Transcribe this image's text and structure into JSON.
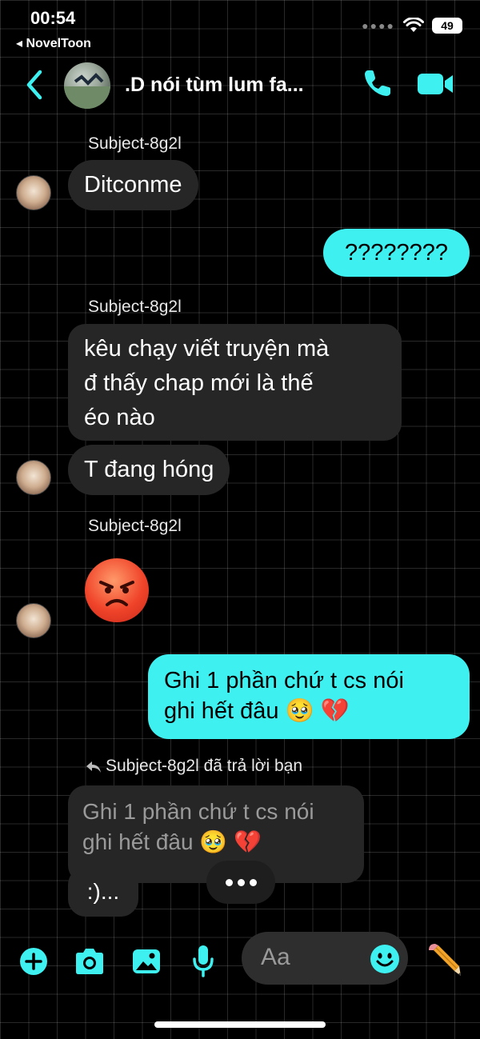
{
  "status": {
    "time": "00:54",
    "back_app": "◂ NovelToon",
    "battery": "49"
  },
  "header": {
    "title": ".D nói tùm lum fa..."
  },
  "messages": {
    "sender1": "Subject-8g2l",
    "m1": "Ditconme",
    "m2": "????????",
    "sender2": "Subject-8g2l",
    "m3_line1": "kêu chạy viết truyện mà",
    "m3_line2": "đ thấy chap mới là thế",
    "m3_line3": "éo nào",
    "m4": "T đang hóng",
    "sender3": "Subject-8g2l",
    "m6_line1": "Ghi 1 phần chứ t cs nói",
    "m6_line2": "ghi hết đâu 🥹 💔",
    "reply_label": "Subject-8g2l đã trả lời bạn",
    "quoted_line1": "Ghi 1 phần chứ t cs nói",
    "quoted_line2": "ghi hết đâu 🥹 💔",
    "m7": ":)..."
  },
  "composer": {
    "placeholder": "Aa"
  },
  "colors": {
    "accent": "#3ff0f0",
    "incoming_bubble": "#262626"
  },
  "icons": [
    "chevron-left-icon",
    "phone-icon",
    "video-icon",
    "plus-icon",
    "camera-icon",
    "image-icon",
    "microphone-icon",
    "emoji-icon",
    "pencil-icon",
    "wifi-icon",
    "reply-arrow-icon"
  ]
}
